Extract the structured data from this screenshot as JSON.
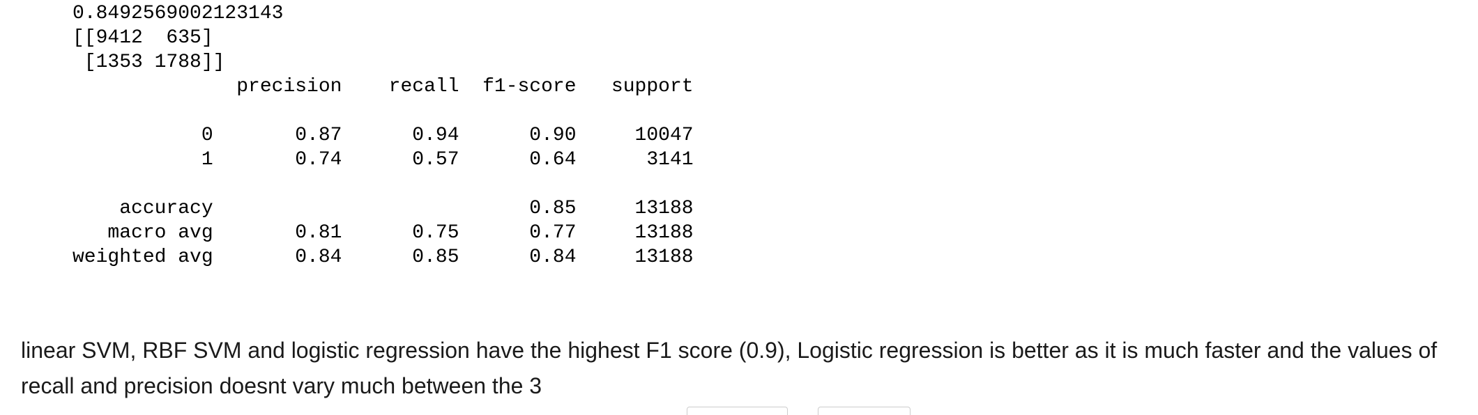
{
  "output": {
    "lines": [
      "0.8492569002123143",
      "[[9412  635]",
      " [1353 1788]]",
      "              precision    recall  f1-score   support",
      "",
      "           0       0.87      0.94      0.90     10047",
      "           1       0.74      0.57      0.64      3141",
      "",
      "    accuracy                           0.85     13188",
      "   macro avg       0.81      0.75      0.77     13188",
      "weighted avg       0.84      0.85      0.84     13188"
    ]
  },
  "markdown": {
    "text": "linear SVM, RBF SVM and logistic regression have the highest F1 score (0.9), Logistic regression is better as it is much faster and the values of recall and precision doesnt vary much between the 3"
  }
}
